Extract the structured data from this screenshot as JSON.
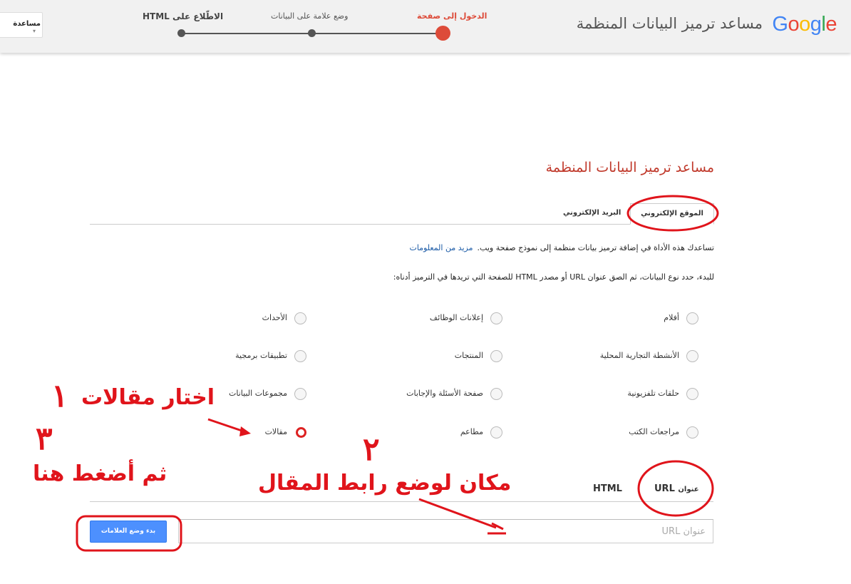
{
  "header": {
    "logo": {
      "letters": [
        "G",
        "o",
        "o",
        "g",
        "l",
        "e"
      ],
      "colors": [
        "#4285f4",
        "#ea4335",
        "#fbbc05",
        "#4285f4",
        "#34a853",
        "#ea4335"
      ]
    },
    "title": "مساعد ترميز البيانات المنظمة",
    "help_label": "مساعدة",
    "steps": [
      {
        "label": "الدخول إلى صفحة",
        "active": true
      },
      {
        "label": "وضع علامة على البيانات",
        "active": false
      },
      {
        "label": "الاطّلاع على HTML",
        "active": false
      }
    ]
  },
  "main": {
    "title": "مساعد ترميز البيانات المنظمة",
    "tabs": [
      {
        "label": "الموقع الإلكتروني",
        "selected": true
      },
      {
        "label": "البريد الإلكتروني",
        "selected": false
      }
    ],
    "intro": "تساعدك هذه الأداة في إضافة ترميز بيانات منظمة إلى نموذج صفحة ويب.",
    "intro_link": "مزيد من المعلومات",
    "instructions": "للبدء، حدد نوع البيانات، ثم الصق عنوان URL أو مصدر HTML للصفحة التي تريدها في الترميز أدناه:",
    "data_types": [
      {
        "label": "أفلام",
        "selected": false
      },
      {
        "label": "إعلانات الوظائف",
        "selected": false
      },
      {
        "label": "الأحداث",
        "selected": false
      },
      {
        "label": "الأنشطة التجارية المحلية",
        "selected": false
      },
      {
        "label": "المنتجات",
        "selected": false
      },
      {
        "label": "تطبيقات برمجية",
        "selected": false
      },
      {
        "label": "حلقات تلفزيونية",
        "selected": false
      },
      {
        "label": "صفحة الأسئلة والإجابات",
        "selected": false
      },
      {
        "label": "مجموعات البيانات",
        "selected": false
      },
      {
        "label": "مراجعات الكتب",
        "selected": false
      },
      {
        "label": "مطاعم",
        "selected": false
      },
      {
        "label": "مقالات",
        "selected": true
      }
    ],
    "source_tabs": {
      "url_prefix": "عنوان",
      "url_suffix": "URL",
      "html": "HTML"
    },
    "url_placeholder": "عنوان URL",
    "start_button": "بدء وضع العلامات"
  },
  "annotations": {
    "step1_text": "اختار مقالات",
    "step1_number": "١",
    "step2_text": "مكان لوضع رابط المقال",
    "step2_number": "٢",
    "step3_text": "ثم أضغط هنا",
    "step3_number": "٣",
    "color": "#e0141b"
  }
}
